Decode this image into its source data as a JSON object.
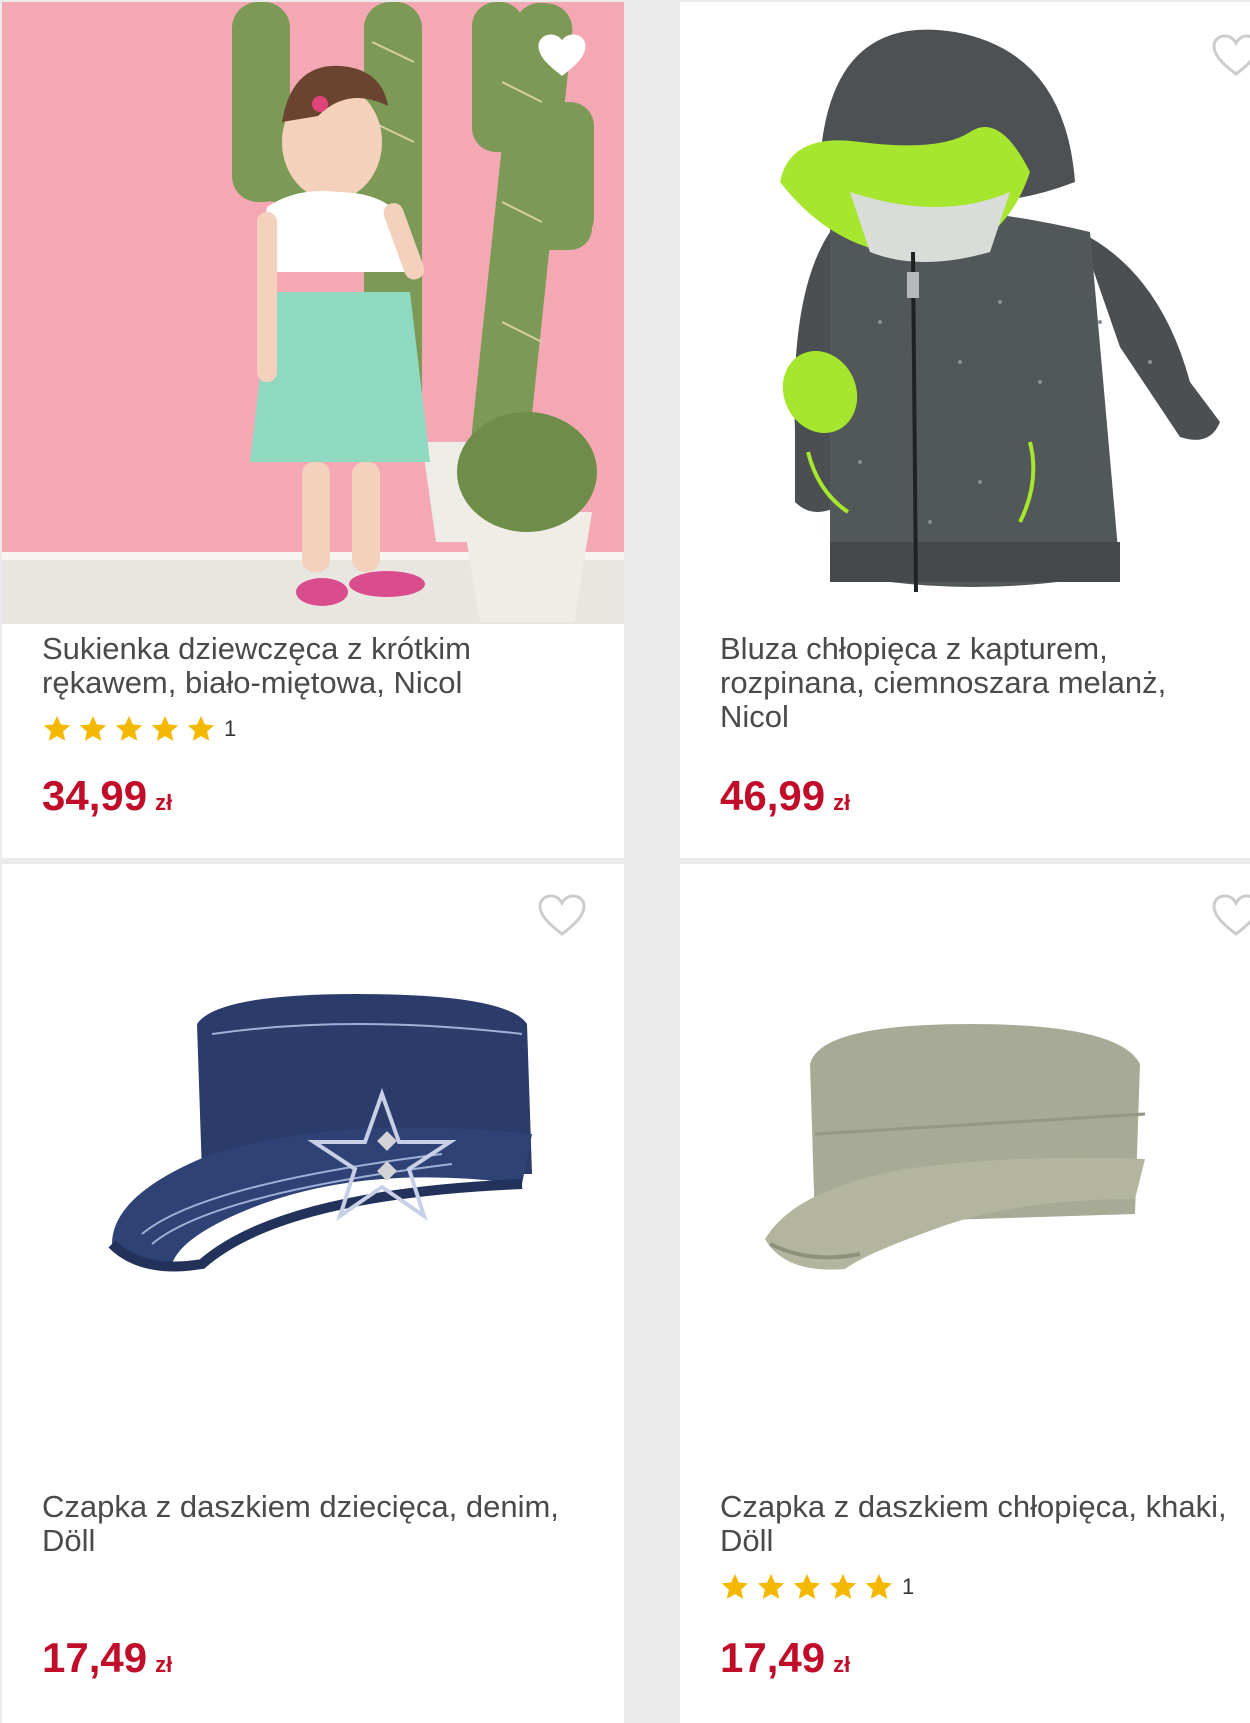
{
  "colors": {
    "price": "#c00e2a",
    "star": "#f5b800",
    "heart_outline": "#cccccc",
    "background": "#ebebeb"
  },
  "products": [
    {
      "title": "Sukienka dziewczęca z krótkim rękawem, biało-miętowa, Nicol",
      "price": "34,99",
      "currency": "zł",
      "rating_count": "1",
      "rating_stars": 5,
      "image": "girl-dress-cactus-photo",
      "favorite_icon": "heart-icon"
    },
    {
      "title": "Bluza chłopięca z kapturem, rozpinana, ciemnoszara melanż, Nicol",
      "price": "46,99",
      "currency": "zł",
      "image": "grey-hoodie-photo",
      "favorite_icon": "heart-icon"
    },
    {
      "title": "Czapka z daszkiem dziecięca, denim, Döll",
      "price": "17,49",
      "currency": "zł",
      "image": "denim-cap-photo",
      "favorite_icon": "heart-icon"
    },
    {
      "title": "Czapka z daszkiem chłopięca, khaki, Döll",
      "price": "17,49",
      "currency": "zł",
      "rating_count": "1",
      "rating_stars": 5,
      "image": "khaki-cap-photo",
      "favorite_icon": "heart-icon"
    }
  ]
}
